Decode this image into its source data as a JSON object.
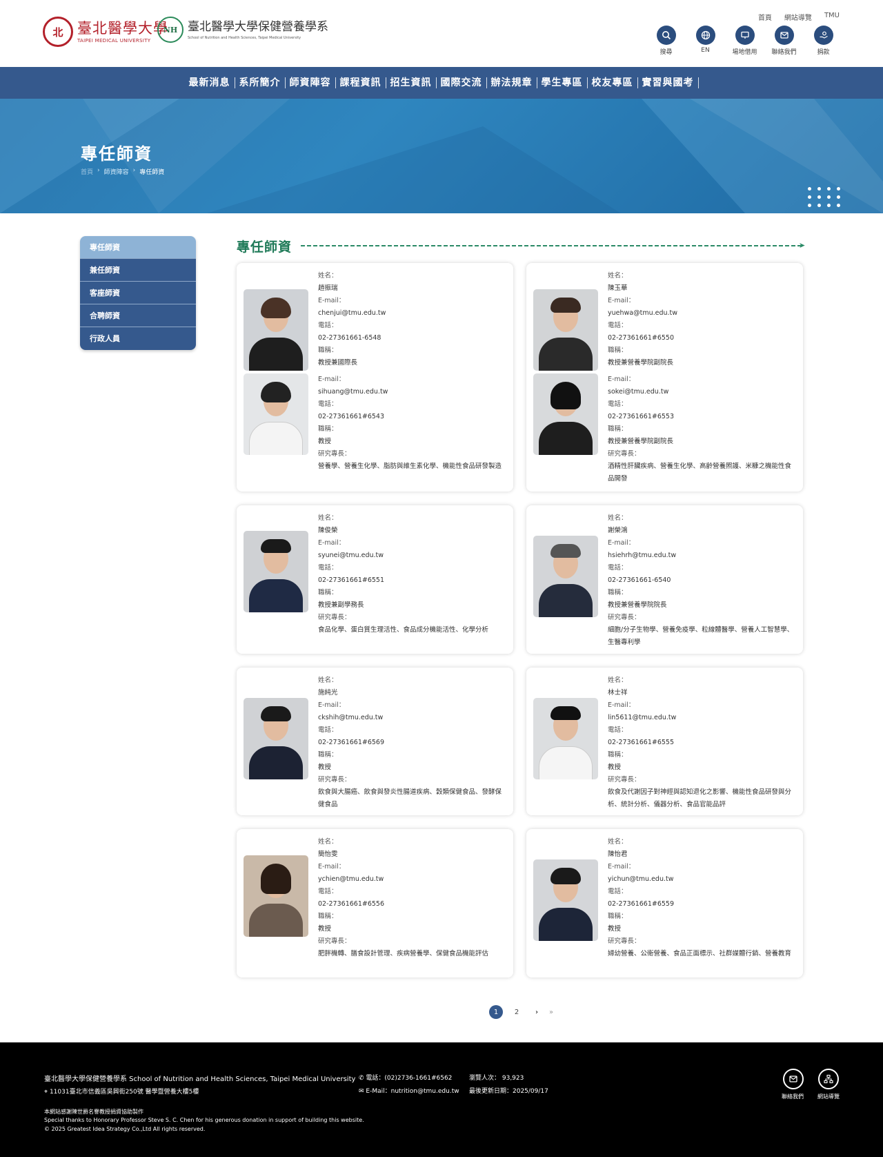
{
  "header": {
    "logo1_cn": "臺北醫學大學",
    "logo1_en": "TAIPEI MEDICAL UNIVERSITY",
    "logo1_seal": "北",
    "logo2_mark": "NH",
    "logo2_cn": "臺北醫學大學保健營養學系",
    "logo2_en": "School of Nutrition and Health Sciences, Taipei Medical University",
    "toplinks": [
      "首頁",
      "網站導覽",
      "TMU"
    ],
    "tools": [
      {
        "label": "搜尋",
        "icon": "search-icon"
      },
      {
        "label": "EN",
        "icon": "globe-icon"
      },
      {
        "label": "場地借用",
        "icon": "monitor-icon"
      },
      {
        "label": "聯絡我們",
        "icon": "mail-icon"
      },
      {
        "label": "捐款",
        "icon": "donate-icon"
      }
    ]
  },
  "nav": [
    "最新消息",
    "系所簡介",
    "師資陣容",
    "課程資訊",
    "招生資訊",
    "國際交流",
    "辦法規章",
    "學生專區",
    "校友專區",
    "實習與國考"
  ],
  "banner": {
    "title": "專任師資",
    "crumb": [
      "首頁",
      "師資陣容",
      "專任師資"
    ]
  },
  "sidebar": [
    "專任師資",
    "兼任師資",
    "客座師資",
    "合聘師資",
    "行政人員"
  ],
  "section_title": "專任師資",
  "labels": {
    "name": "姓名：",
    "email": "E-mail：",
    "phone": "電話：",
    "title": "職稱：",
    "research": "研究專長："
  },
  "faculty": [
    {
      "name": "趙振瑞",
      "email": "chenjui@tmu.edu.tw",
      "phone": "02-27361661-6548",
      "title": "教授兼國際長",
      "research": ""
    },
    {
      "name": "陳玉華",
      "email": "yuehwa@tmu.edu.tw",
      "phone": "02-27361661#6550",
      "title": "教授兼營養學院副院長",
      "research": ""
    },
    {
      "name": "",
      "email": "sihuang@tmu.edu.tw",
      "phone": "02-27361661#6543",
      "title": "教授",
      "research": "營養學、營養生化學、脂肪與維生素化學、機能性食品研發製造"
    },
    {
      "name": "",
      "email": "sokei@tmu.edu.tw",
      "phone": "02-27361661#6553",
      "title": "教授兼營養學院副院長",
      "research": "酒精性肝臟疾病、營養生化學、高齡營養照護、米糠之機能性食品開發"
    },
    {
      "name": "陳俊榮",
      "email": "syunei@tmu.edu.tw",
      "phone": "02-27361661#6551",
      "title": "教授兼副學務長",
      "research": "食品化學、蛋白質生理活性、食品成分機能活性、化學分析"
    },
    {
      "name": "謝榮鴻",
      "email": "hsiehrh@tmu.edu.tw",
      "phone": "02-27361661-6540",
      "title": "教授兼營養學院院長",
      "research": "細胞/分子生物學、營養免疫學、粒線體醫學、營養人工智慧學、生醫專利學"
    },
    {
      "name": "施純光",
      "email": "ckshih@tmu.edu.tw",
      "phone": "02-27361661#6569",
      "title": "教授",
      "research": "飲食與大腸癌、飲食與發炎性腸道疾病、穀類保健食品、發酵保健食品"
    },
    {
      "name": "林士祥",
      "email": "lin5611@tmu.edu.tw",
      "phone": "02-27361661#6555",
      "title": "教授",
      "research": "飲食及代謝因子對神經與認知退化之影響、機能性食品研發與分析、統計分析、儀器分析、食品官能品評"
    },
    {
      "name": "簡怡雯",
      "email": "ychien@tmu.edu.tw",
      "phone": "02-27361661#6556",
      "title": "教授",
      "research": "肥胖機轉、膳食設計管理、疾病營養學、保健食品機能評估"
    },
    {
      "name": "陳怡君",
      "email": "yichun@tmu.edu.tw",
      "phone": "02-27361661#6559",
      "title": "教授",
      "research": "婦幼營養、公衛營養、食品正面標示、社群媒體行銷、營養教育"
    }
  ],
  "pagination": {
    "pages": [
      "1",
      "2"
    ],
    "next": "›",
    "last": "»"
  },
  "footer": {
    "school": "臺北醫學大學保健營養學系 School of Nutrition and Health Sciences, Taipei Medical University",
    "address": "11031臺北市信義區吳興街250號 醫學暨營養大樓5樓",
    "phone": "電話：(02)2736-1661#6562",
    "email": "E-Mail：nutrition@tmu.edu.tw",
    "visitors": "瀏覽人次： 93,923",
    "updated": "最後更新日期：2025/09/17",
    "credit1": "本網站感謝陳世爵名譽教授捐資協助製作",
    "credit2": "Special thanks to Honorary Professor Steve S. C. Chen for his generous donation in support of building this website.",
    "copyright": "© 2025 Greatest Idea Strategy Co.,Ltd All rights reserved.",
    "contact_label": "聯絡我們",
    "sitemap_label": "網站導覽"
  }
}
